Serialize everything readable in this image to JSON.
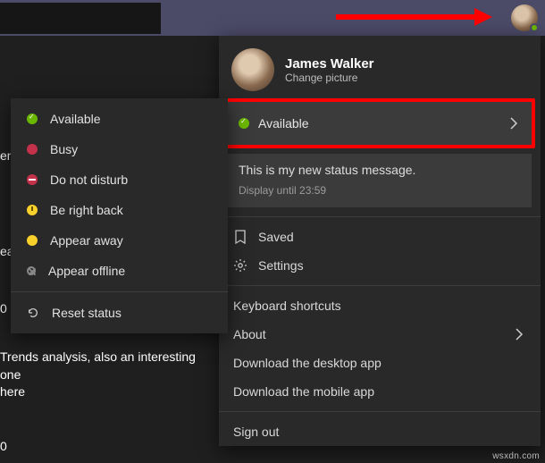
{
  "user": {
    "name": "James Walker",
    "change_picture": "Change picture"
  },
  "status": {
    "current": "Available",
    "message": "This is my new status message.",
    "display_until": "Display until 23:59"
  },
  "status_options": {
    "available": "Available",
    "busy": "Busy",
    "dnd": "Do not disturb",
    "brb": "Be right back",
    "away": "Appear away",
    "offline": "Appear offline",
    "reset": "Reset status"
  },
  "menu": {
    "saved": "Saved",
    "settings": "Settings",
    "shortcuts": "Keyboard shortcuts",
    "about": "About",
    "download_desktop": "Download the desktop app",
    "download_mobile": "Download the mobile app",
    "signout": "Sign out"
  },
  "bg": {
    "line1": "en",
    "line2": "ea",
    "line3": "0",
    "line4a": "Trends analysis, also an interesting one",
    "line4b": "here",
    "line5": "0"
  },
  "watermark": "wsxdn.com"
}
